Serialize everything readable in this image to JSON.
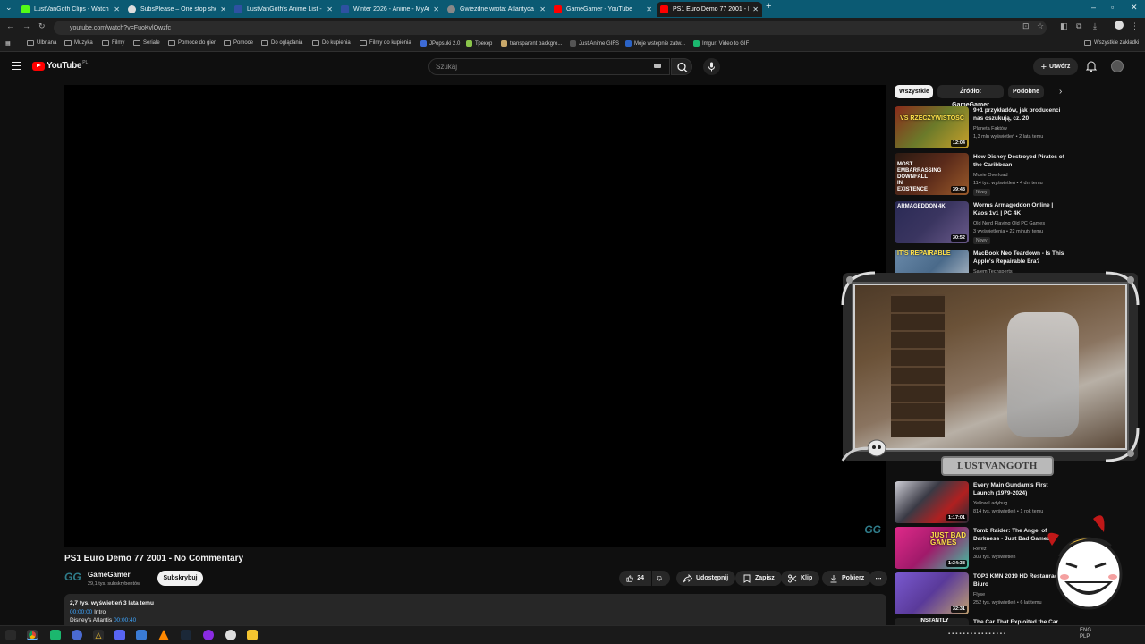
{
  "browser": {
    "tabs": [
      {
        "label": "LustVanGoth Clips - Watch Live",
        "color": "#53fc18"
      },
      {
        "label": "SubsPlease – One stop shop fo",
        "color": "#dddddd"
      },
      {
        "label": "LustVanGoth's Anime List - My",
        "color": "#2e51a2"
      },
      {
        "label": "Winter 2026 - Anime - MyAnim",
        "color": "#2e51a2"
      },
      {
        "label": "Gwiezdne wrota: Atlantyda / St",
        "color": "#888888"
      },
      {
        "label": "GameGamer - YouTube",
        "color": "#ff0000"
      },
      {
        "label": "PS1 Euro Demo 77 2001 - No C",
        "color": "#ff0000"
      }
    ],
    "url": "youtube.com/watch?v=FuoKvlOwzfc",
    "bookmarks": [
      {
        "label": "Ulbriana",
        "type": "folder"
      },
      {
        "label": "Muzyka",
        "type": "folder"
      },
      {
        "label": "Filmy",
        "type": "folder"
      },
      {
        "label": "Seriale",
        "type": "folder"
      },
      {
        "label": "Pomoce do gier",
        "type": "folder"
      },
      {
        "label": "Pomoce",
        "type": "folder"
      },
      {
        "label": "Do oglądania",
        "type": "folder"
      },
      {
        "label": "Do kupienia",
        "type": "folder"
      },
      {
        "label": "Filmy do kupienia",
        "type": "folder"
      },
      {
        "label": "JPopsuki 2.0",
        "type": "site"
      },
      {
        "label": "Трекер",
        "type": "site"
      },
      {
        "label": "transparent backgro...",
        "type": "site"
      },
      {
        "label": "Just Anime GIFS",
        "type": "site"
      },
      {
        "label": "Moje wstępnie zatw...",
        "type": "site"
      },
      {
        "label": "Imgur: Video to GIF",
        "type": "site"
      }
    ],
    "all_bookmarks": "Wszystkie zakładki"
  },
  "youtube": {
    "logo_text": "YouTube",
    "country_code": "PL",
    "search_placeholder": "Szukaj",
    "create_label": "Utwórz",
    "video": {
      "title": "PS1 Euro Demo 77 2001 - No Commentary",
      "watermark": "GG",
      "channel_name": "GameGamer",
      "channel_avatar": "GG",
      "subscribers": "29,1 tys. subskrybentów",
      "subscribe_label": "Subskrybuj",
      "likes": "24",
      "share_label": "Udostępnij",
      "save_label": "Zapisz",
      "clip_label": "Klip",
      "download_label": "Pobierz"
    },
    "description": {
      "stats": "2,7 tys. wyświetleń  3 lata temu",
      "chapters": [
        {
          "time": "00:00:00",
          "label": "Intro"
        },
        {
          "time": "00:00:40",
          "label": "Disney's Atlantis"
        }
      ]
    },
    "chips": [
      "Wszystkie",
      "Źródło: GameGamer",
      "Podobne"
    ],
    "recommendations": [
      {
        "title": "9+1 przykładów, jak producenci nas oszukują, cz. 20",
        "channel": "Planeta Faktów",
        "meta": "1,3 mln wyświetleń • 2 lata temu",
        "duration": "12:04",
        "new": "",
        "thumb_color": "#6b7a2a",
        "thumb_text": "VS RZECZYWISTOŚĆ"
      },
      {
        "title": "How Disney Destroyed Pirates of the Caribbean",
        "channel": "Movie Overload",
        "meta": "114 tys. wyświetleń • 4 dni temu",
        "duration": "39:48",
        "new": "Nowy",
        "thumb_color": "#5a2a1a",
        "thumb_text": "MOST EMBARRASSING DOWNFALL IN EXISTENCE"
      },
      {
        "title": "Worms Armageddon Online | Kaos 1v1 | PC 4K",
        "channel": "Old Nerd Playing Old PC Games",
        "meta": "3 wyświetlenia • 22 minuty temu",
        "duration": "30:52",
        "new": "Nowy",
        "thumb_color": "#3a3560",
        "thumb_text": "ARMAGEDDON 4K"
      },
      {
        "title": "MacBook Neo Teardown - Is This Apple's Repairable Era?",
        "channel": "Salem Techsperts",
        "meta": "38 tys. wyświetleń • 4 godziny temu",
        "duration": "",
        "new": "",
        "thumb_color": "#4a6a8a",
        "thumb_text": "IT'S REPAIRABLE"
      },
      {
        "title": "Every Main Gundam's First Launch (1979-2024)",
        "channel": "Yellow Ladybug",
        "meta": "814 tys. wyświetleń • 1 rok temu",
        "duration": "1:17:01",
        "new": "",
        "thumb_color": "#3a3a45",
        "thumb_text": ""
      },
      {
        "title": "Tomb Raider: The Angel of Darkness - Just Bad Games",
        "channel": "Rerez",
        "meta": "303 tys. wyświetleń",
        "duration": "1:34:38",
        "new": "",
        "thumb_color": "#a01a6a",
        "thumb_text": "JUST BAD GAMES"
      },
      {
        "title": "TOP3 KMN 2019 HD Restauracja, Biuro",
        "channel": "Flyse",
        "meta": "252 tys. wyświetleń • 6 lat temu",
        "duration": "32:31",
        "new": "",
        "thumb_color": "#5a3a9a",
        "thumb_text": ""
      },
      {
        "title": "The Car That Exploited the Car",
        "channel": "",
        "meta": "",
        "duration": "",
        "new": "",
        "thumb_color": "#202020",
        "thumb_text": "INSTANTLY"
      }
    ]
  },
  "overlay": {
    "streamer_badge": "LUSTVANGOTH"
  },
  "taskbar": {
    "lang": "ENG",
    "layout": "PLP"
  }
}
